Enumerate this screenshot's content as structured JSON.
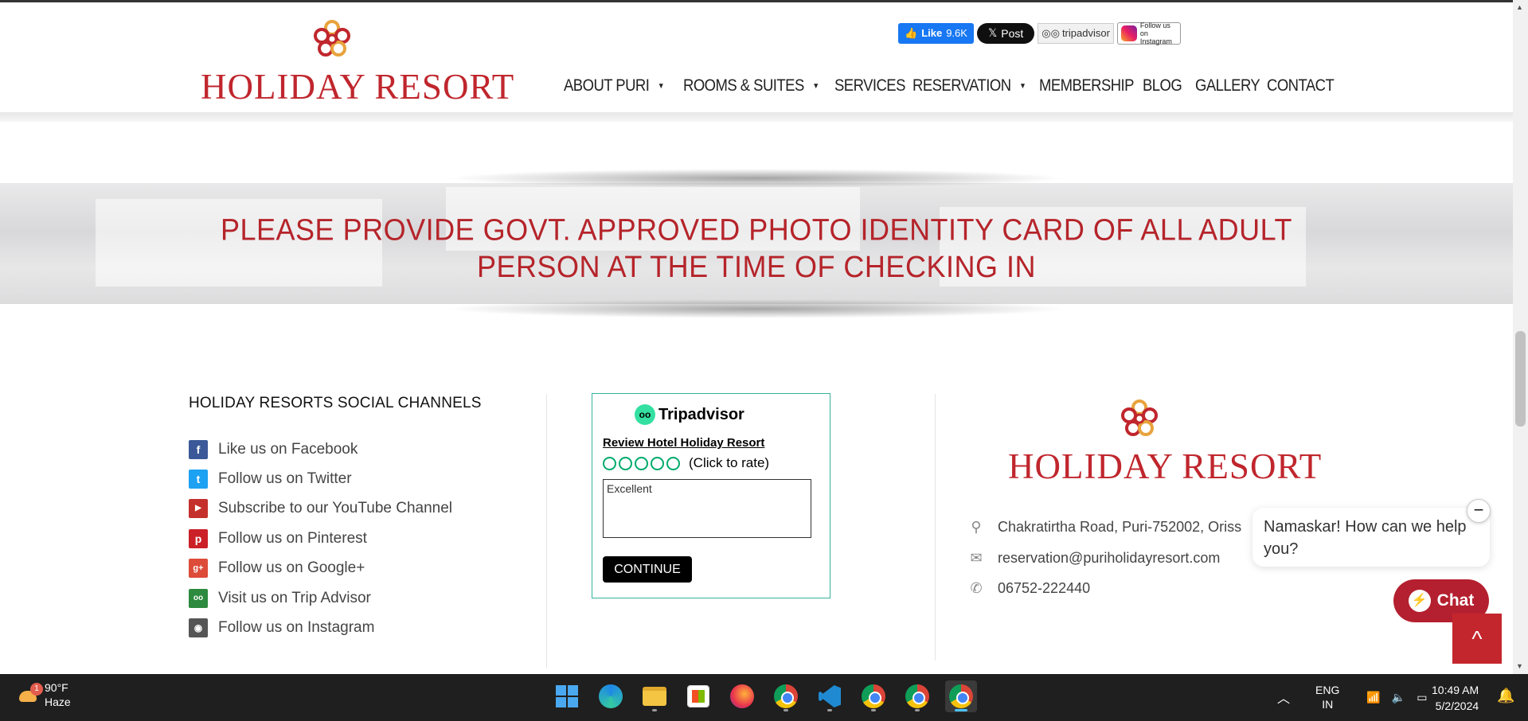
{
  "header": {
    "logo_text": "HOLIDAY RESORT",
    "social": {
      "fb_like_label": "Like",
      "fb_like_count": "9.6K",
      "x_post_label": "Post",
      "tripadvisor_label": "tripadvisor",
      "instagram_label": "Follow us on Instagram"
    },
    "nav": [
      {
        "label": "ABOUT PURI",
        "has_dropdown": true
      },
      {
        "label": "ROOMS & SUITES",
        "has_dropdown": true
      },
      {
        "label": "SERVICES",
        "has_dropdown": false
      },
      {
        "label": "RESERVATION",
        "has_dropdown": true
      },
      {
        "label": "MEMBERSHIP",
        "has_dropdown": false
      },
      {
        "label": "BLOG",
        "has_dropdown": false
      },
      {
        "label": "GALLERY",
        "has_dropdown": false
      },
      {
        "label": "CONTACT",
        "has_dropdown": false
      }
    ]
  },
  "banner": {
    "notice": "PLEASE PROVIDE GOVT. APPROVED PHOTO IDENTITY CARD OF ALL ADULT PERSON AT THE TIME OF CHECKING IN"
  },
  "social_channels": {
    "title": "HOLIDAY RESORTS SOCIAL CHANNELS",
    "links": [
      {
        "label": "Like us on Facebook",
        "icon": "facebook-icon",
        "color": "#3b5998"
      },
      {
        "label": "Follow us on Twitter",
        "icon": "twitter-icon",
        "color": "#1da1f2"
      },
      {
        "label": "Subscribe to our YouTube Channel",
        "icon": "youtube-icon",
        "color": "#c4302b"
      },
      {
        "label": "Follow us on Pinterest",
        "icon": "pinterest-icon",
        "color": "#cb2027"
      },
      {
        "label": "Follow us on Google+",
        "icon": "google-plus-icon",
        "color": "#dd4b39"
      },
      {
        "label": "Visit us on Trip Advisor",
        "icon": "tripadvisor-icon",
        "color": "#2d8a3e"
      },
      {
        "label": "Follow us on Instagram",
        "icon": "instagram-icon",
        "color": "#555555"
      }
    ]
  },
  "tripadvisor_widget": {
    "brand": "Tripadvisor",
    "review_link": "Review Hotel Holiday Resort",
    "rating_hint": "(Click to rate)",
    "textarea_value": "Excellent",
    "continue_label": "CONTINUE",
    "accent": "#34b39d"
  },
  "contact": {
    "logo_text": "HOLIDAY RESORT",
    "address": "Chakratirtha Road, Puri-752002, Oriss",
    "email": "reservation@puriholidayresort.com",
    "phone": "06752-222440"
  },
  "chat": {
    "greeting": "Namaskar! How can we help you?",
    "button_label": "Chat",
    "minimize_label": "−",
    "accent": "#b4202f"
  },
  "back_to_top_label": "^",
  "taskbar": {
    "weather": {
      "badge": "1",
      "temp": "90°F",
      "condition": "Haze"
    },
    "language": {
      "line1": "ENG",
      "line2": "IN"
    },
    "time": "10:49 AM",
    "date": "5/2/2024"
  },
  "colors": {
    "brand_red": "#c0262d",
    "banner_text": "#b5242a"
  }
}
